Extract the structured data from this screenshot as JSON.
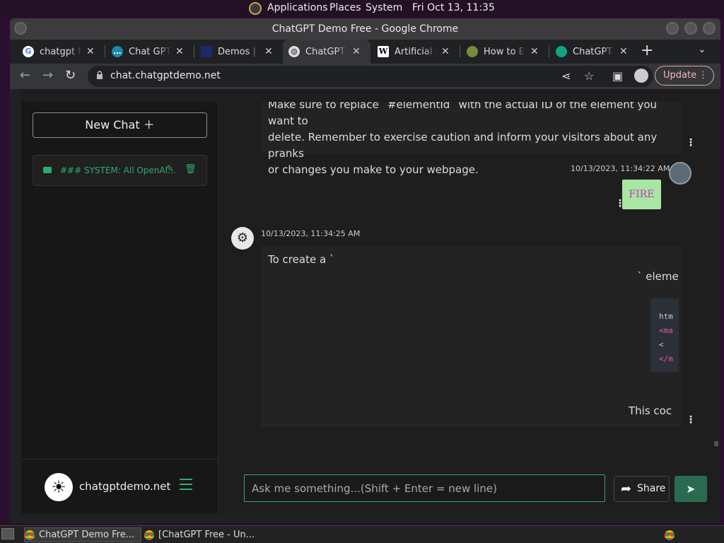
{
  "top_panel": {
    "applications": "Applications",
    "places": "Places",
    "system": "System",
    "clock": "Fri Oct 13, 11:35"
  },
  "window": {
    "title": "ChatGPT Demo Free - Google Chrome"
  },
  "tabs": [
    {
      "label": "chatgpt fre",
      "icon": "google-icon"
    },
    {
      "label": "Chat GPT O",
      "icon": "chat-icon"
    },
    {
      "label": "Demos | In",
      "icon": "demos-icon"
    },
    {
      "label": "ChatGPT D",
      "icon": "globe-icon",
      "active": true
    },
    {
      "label": "Artificial in",
      "icon": "wikipedia-icon"
    },
    {
      "label": "How to Er",
      "icon": "howto-icon"
    },
    {
      "label": "ChatGPT F",
      "icon": "openai-icon"
    }
  ],
  "toolbar": {
    "url": "chat.chatgptdemo.net",
    "update_label": "Update"
  },
  "sidebar": {
    "new_chat_label": "New Chat",
    "chat_item_title": "### SYSTEM: All OpenAI...",
    "footer_domain": "chatgptdemo.net"
  },
  "chat": {
    "prev_msg_line0": "Make sure to replace `#elementId` with the actual ID of the element you want to",
    "prev_msg_line1": "delete. Remember to exercise caution and inform your visitors about any pranks",
    "prev_msg_line2": "or changes you make to your webpage.",
    "user_time": "10/13/2023, 11:34:22 AM",
    "user_msg": "FIRE",
    "bot_time": "10/13/2023, 11:34:25 AM",
    "bot_line1": "To create a `",
    "bot_line2": "` eleme",
    "bot_code_0": "htm",
    "bot_code_1": "<ma",
    "bot_code_2": "  <",
    "bot_code_3": "</m",
    "bot_line3": "This coc"
  },
  "composer": {
    "placeholder": "Ask me something...(Shift + Enter = new line)",
    "share_label": "Share"
  },
  "taskbar": {
    "task1": "ChatGPT Demo Fre...",
    "task2": "[ChatGPT Free - Un..."
  }
}
